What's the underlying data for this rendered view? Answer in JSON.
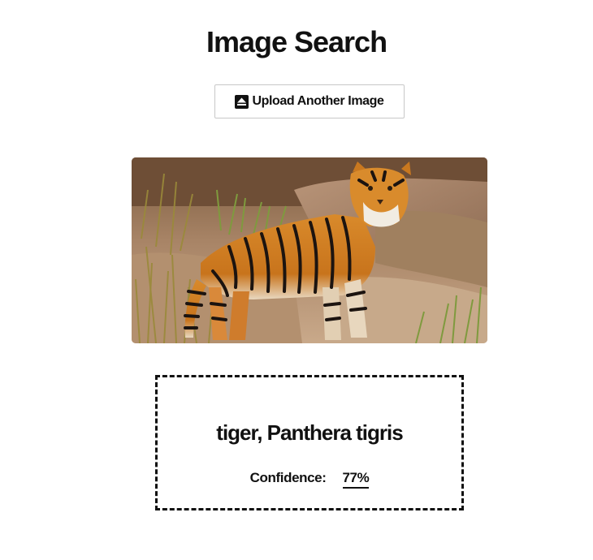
{
  "header": {
    "title": "Image Search"
  },
  "upload": {
    "label": "Upload Another Image",
    "icon": "eject-icon"
  },
  "image": {
    "subject": "tiger-photo"
  },
  "result": {
    "label": "tiger, Panthera tigris",
    "confidence_label": "Confidence:",
    "confidence_value": "77%"
  },
  "colors": {
    "text": "#111111",
    "button_border": "#c8c8c8",
    "background": "#ffffff"
  }
}
